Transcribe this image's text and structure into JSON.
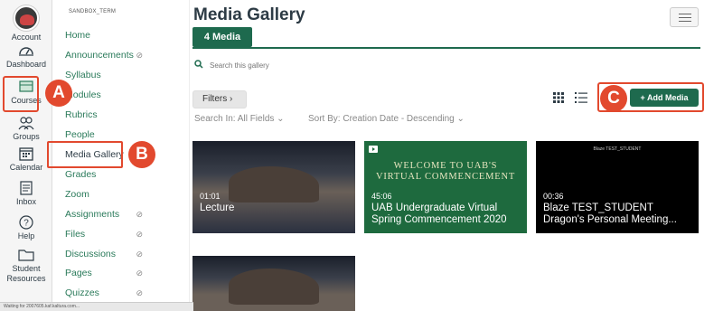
{
  "global_nav": [
    {
      "label": "Account",
      "icon": "account-avatar"
    },
    {
      "label": "Dashboard",
      "icon": "dashboard-icon"
    },
    {
      "label": "Courses",
      "icon": "courses-icon"
    },
    {
      "label": "Groups",
      "icon": "groups-icon"
    },
    {
      "label": "Calendar",
      "icon": "calendar-icon"
    },
    {
      "label": "Inbox",
      "icon": "inbox-icon"
    },
    {
      "label": "Help",
      "icon": "help-icon"
    },
    {
      "label": "Student Resources",
      "icon": "folder-icon"
    }
  ],
  "course": {
    "code": "SANDBOX_TERM",
    "nav": [
      {
        "label": "Home"
      },
      {
        "label": "Announcements",
        "hidden": true
      },
      {
        "label": "Syllabus"
      },
      {
        "label": "Modules"
      },
      {
        "label": "Rubrics"
      },
      {
        "label": "People"
      },
      {
        "label": "Media Gallery"
      },
      {
        "label": "Grades"
      },
      {
        "label": "Zoom"
      },
      {
        "label": "Assignments",
        "hidden": true
      },
      {
        "label": "Files",
        "hidden": true
      },
      {
        "label": "Discussions",
        "hidden": true
      },
      {
        "label": "Pages",
        "hidden": true
      },
      {
        "label": "Quizzes",
        "hidden": true
      }
    ]
  },
  "page": {
    "title": "Media Gallery",
    "tab_label": "4 Media",
    "search_placeholder": "Search this gallery",
    "filters_label": "Filters",
    "search_in": "Search In: All Fields",
    "sort_by": "Sort By: Creation Date - Descending",
    "add_media_label": "+ Add Media"
  },
  "callouts": {
    "a": "A",
    "b": "B",
    "c": "C"
  },
  "media": [
    {
      "duration": "01:01",
      "name": "Lecture"
    },
    {
      "duration": "45:06",
      "name": "UAB Undergraduate Virtual Spring Commencement 2020",
      "thumb_text": "WELCOME TO UAB'S VIRTUAL COMMENCEMENT"
    },
    {
      "duration": "00:36",
      "name": "Blaze TEST_STUDENT Dragon's Personal Meeting...",
      "thumb_text": "Blaze TEST_STUDENT"
    }
  ],
  "status_text": "Waiting for 2007605.kaf.kaltura.com...",
  "colors": {
    "accent": "#1e6a4e",
    "callout": "#e2492e",
    "link": "#2a7a5a"
  }
}
